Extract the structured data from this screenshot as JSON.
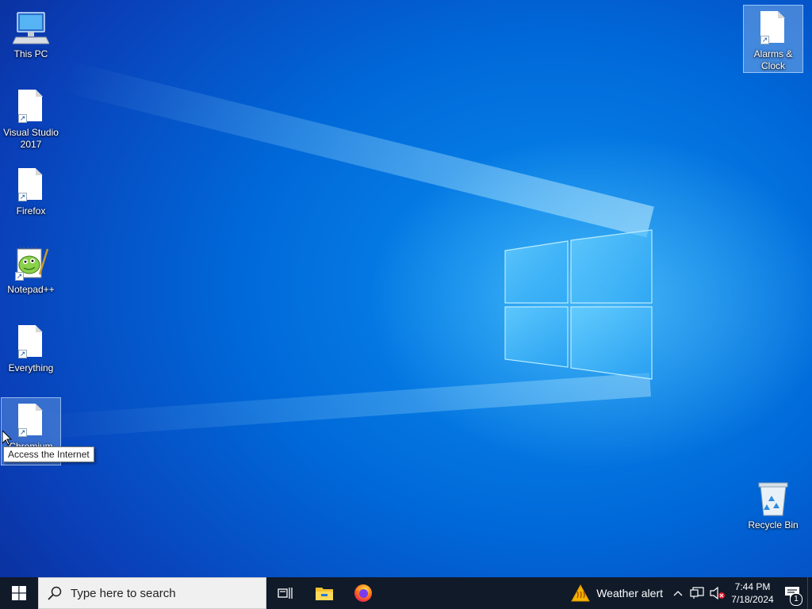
{
  "desktop": {
    "icons": [
      {
        "label": "This PC",
        "icon": "computer-icon"
      },
      {
        "label": "Visual Studio 2017",
        "icon": "file-shortcut-icon"
      },
      {
        "label": "Firefox",
        "icon": "file-shortcut-icon"
      },
      {
        "label": "Notepad++",
        "icon": "notepadpp-icon"
      },
      {
        "label": "Everything",
        "icon": "file-shortcut-icon"
      },
      {
        "label": "Chromium",
        "icon": "file-shortcut-icon"
      },
      {
        "label": "Alarms & Clock",
        "icon": "file-shortcut-icon"
      },
      {
        "label": "Recycle Bin",
        "icon": "recycle-bin-icon"
      }
    ]
  },
  "tooltip": {
    "text": "Access the Internet"
  },
  "taskbar": {
    "search_placeholder": "Type here to search",
    "weather_label": "Weather alert",
    "clock_time": "7:44 PM",
    "clock_date": "7/18/2024",
    "notification_count": "1"
  },
  "colors": {
    "taskbar_bg": "#101a29",
    "desktop_accent": "#0a8ef0"
  }
}
